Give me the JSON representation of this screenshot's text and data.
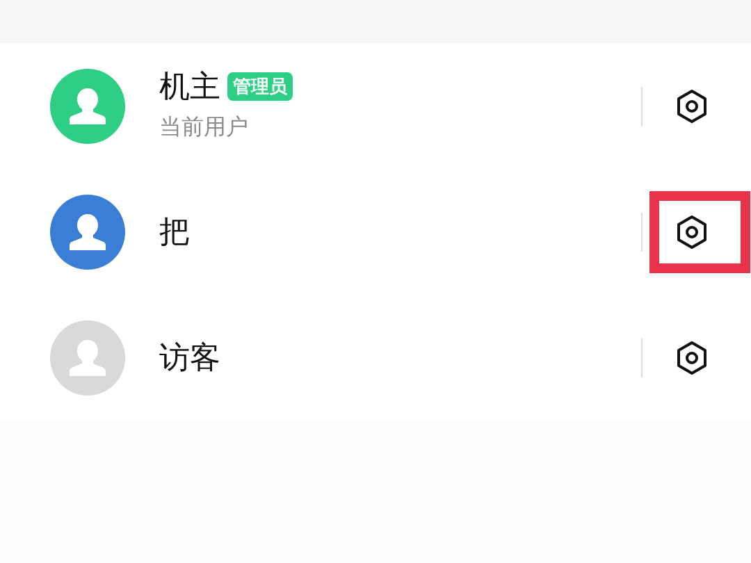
{
  "users": [
    {
      "name": "机主",
      "badge": "管理员",
      "subtitle": "当前用户",
      "color": "#2ecf85",
      "highlighted": false
    },
    {
      "name": "把",
      "color": "#3a7fd5",
      "highlighted": true
    },
    {
      "name": "访客",
      "color": "#d9d9d9",
      "highlighted": false
    }
  ]
}
